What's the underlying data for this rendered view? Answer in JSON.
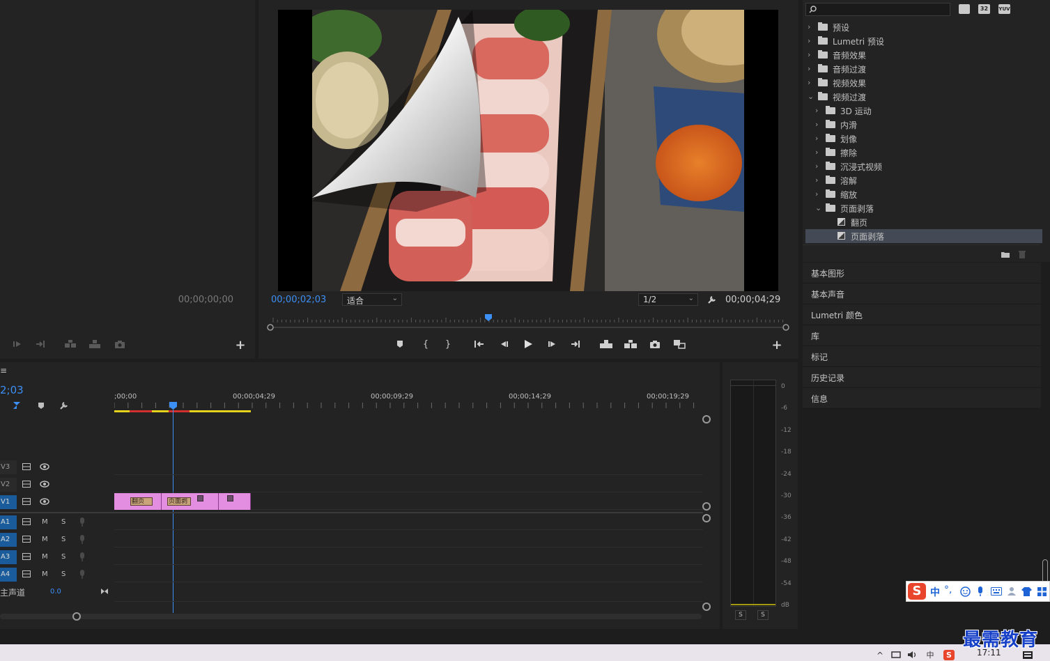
{
  "source_monitor": {
    "timecode": "00;00;00;00"
  },
  "program_monitor": {
    "current_timecode": "00;00;02;03",
    "fit_option": "适合",
    "resolution_option": "1/2",
    "duration_timecode": "00;00;04;29"
  },
  "timeline": {
    "sequence_timecode": "2;03",
    "ruler_labels": [
      ";00;00",
      "00;00;04;29",
      "00;00;09;29",
      "00;00;14;29",
      "00;00;19;29"
    ],
    "video_tracks": [
      {
        "name": "V3"
      },
      {
        "name": "V2"
      },
      {
        "name": "V1"
      }
    ],
    "audio_tracks": [
      {
        "name": "A1",
        "m": "M",
        "s": "S"
      },
      {
        "name": "A2",
        "m": "M",
        "s": "S"
      },
      {
        "name": "A3",
        "m": "M",
        "s": "S"
      },
      {
        "name": "A4",
        "m": "M",
        "s": "S"
      }
    ],
    "master": {
      "label": "主声道",
      "value": "0.0"
    },
    "clip_labels": {
      "flip": "翻页",
      "peel": "页面剥"
    }
  },
  "audio_meter": {
    "scale": [
      "0",
      "-6",
      "-12",
      "-18",
      "-24",
      "-30",
      "-36",
      "-42",
      "-48",
      "-54",
      "dB"
    ],
    "solo_buttons": [
      "S",
      "S"
    ]
  },
  "effects": {
    "badges": [
      "32",
      "YUV"
    ],
    "tree": [
      {
        "label": "预设",
        "level": 0,
        "expanded": false,
        "type": "preset"
      },
      {
        "label": "Lumetri 预设",
        "level": 0,
        "expanded": false,
        "type": "preset"
      },
      {
        "label": "音频效果",
        "level": 0,
        "expanded": false,
        "type": "folder"
      },
      {
        "label": "音频过渡",
        "level": 0,
        "expanded": false,
        "type": "folder"
      },
      {
        "label": "视频效果",
        "level": 0,
        "expanded": false,
        "type": "folder"
      },
      {
        "label": "视频过渡",
        "level": 0,
        "expanded": true,
        "type": "folder"
      },
      {
        "label": "3D 运动",
        "level": 1,
        "expanded": false,
        "type": "folder"
      },
      {
        "label": "内滑",
        "level": 1,
        "expanded": false,
        "type": "folder"
      },
      {
        "label": "划像",
        "level": 1,
        "expanded": false,
        "type": "folder"
      },
      {
        "label": "擦除",
        "level": 1,
        "expanded": false,
        "type": "folder"
      },
      {
        "label": "沉浸式视频",
        "level": 1,
        "expanded": false,
        "type": "folder"
      },
      {
        "label": "溶解",
        "level": 1,
        "expanded": false,
        "type": "folder"
      },
      {
        "label": "缩放",
        "level": 1,
        "expanded": false,
        "type": "folder"
      },
      {
        "label": "页面剥落",
        "level": 1,
        "expanded": true,
        "type": "folder"
      },
      {
        "label": "翻页",
        "level": 2,
        "type": "effect"
      },
      {
        "label": "页面剥落",
        "level": 2,
        "type": "effect",
        "selected": true
      }
    ]
  },
  "panels": [
    "基本图形",
    "基本声音",
    "Lumetri 颜色",
    "库",
    "标记",
    "历史记录",
    "信息"
  ],
  "ime": {
    "label": "中"
  },
  "system": {
    "clock": "17:11"
  },
  "watermark": "最需教育",
  "colors": {
    "accent": "#3c8ff5",
    "clip": "#e48ee1",
    "track_on": "#1a5c9b"
  }
}
